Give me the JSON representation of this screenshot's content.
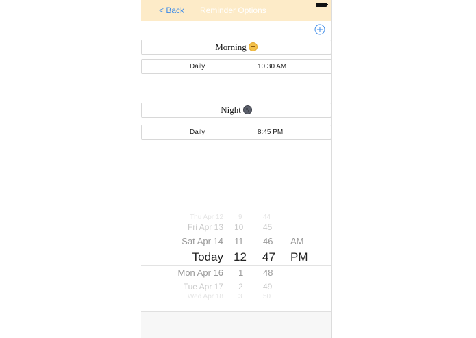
{
  "navbar": {
    "back_label": "< Back",
    "title": "Reminder Options"
  },
  "sections": [
    {
      "title": "Morning",
      "emoji": "sleepy-face-icon",
      "reminder": {
        "frequency": "Daily",
        "time": "10:30 AM"
      }
    },
    {
      "title": "Night",
      "emoji": "new-moon-face-icon",
      "reminder": {
        "frequency": "Daily",
        "time": "8:45 PM"
      }
    }
  ],
  "picker": {
    "days": [
      "Thu Apr 12",
      "Fri Apr 13",
      "Sat Apr 14",
      "Today",
      "Mon Apr 16",
      "Tue Apr 17",
      "Wed Apr 18"
    ],
    "hours": [
      "9",
      "10",
      "11",
      "12",
      "1",
      "2",
      "3"
    ],
    "minutes": [
      "44",
      "45",
      "46",
      "47",
      "48",
      "49",
      "50"
    ],
    "ampm": [
      "AM",
      "PM"
    ],
    "selected": {
      "day": "Today",
      "hour": "12",
      "minute": "47",
      "ampm": "PM"
    }
  },
  "colors": {
    "navbar_bg": "#fdebc8",
    "accent": "#3d8be8"
  }
}
